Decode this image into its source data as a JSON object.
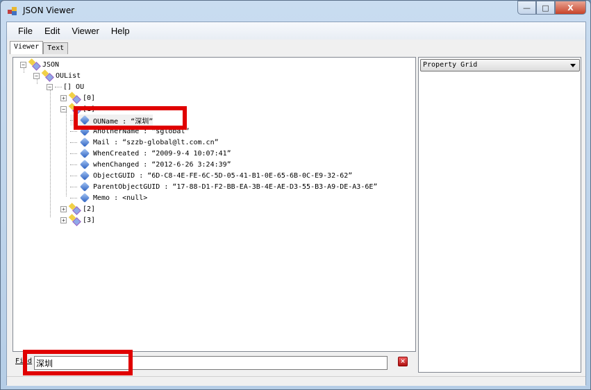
{
  "window": {
    "title": "JSON Viewer",
    "minimize": "—",
    "maximize": "□",
    "close": "X"
  },
  "menu": [
    "File",
    "Edit",
    "Viewer",
    "Help"
  ],
  "tabs": [
    {
      "label": "Viewer",
      "active": true
    },
    {
      "label": "Text",
      "active": false
    }
  ],
  "tree": {
    "root": "JSON",
    "oulist": "OUList",
    "ou": "[] OU",
    "items": [
      "[0]",
      "[1]",
      "[2]",
      "[3]"
    ],
    "expanded_props": [
      "OUName : “深圳”",
      "AnotherName : “sglobal”",
      "Mail : “szzb-global@lt.com.cn”",
      "WhenCreated : “2009-9-4 10:07:41”",
      "whenChanged : “2012-6-26 3:24:39”",
      "ObjectGUID : “6D-C8-4E-FE-6C-5D-05-41-B1-0E-65-6B-0C-E9-32-62”",
      "ParentObjectGUID : “17-88-D1-F2-BB-EA-3B-4E-AE-D3-55-B3-A9-DE-A3-6E”",
      "Memo : <null>"
    ]
  },
  "side": {
    "dropdown": "Property Grid"
  },
  "find": {
    "label": "Find",
    "value": "深圳"
  },
  "colors": {
    "highlight": "#e00000"
  }
}
